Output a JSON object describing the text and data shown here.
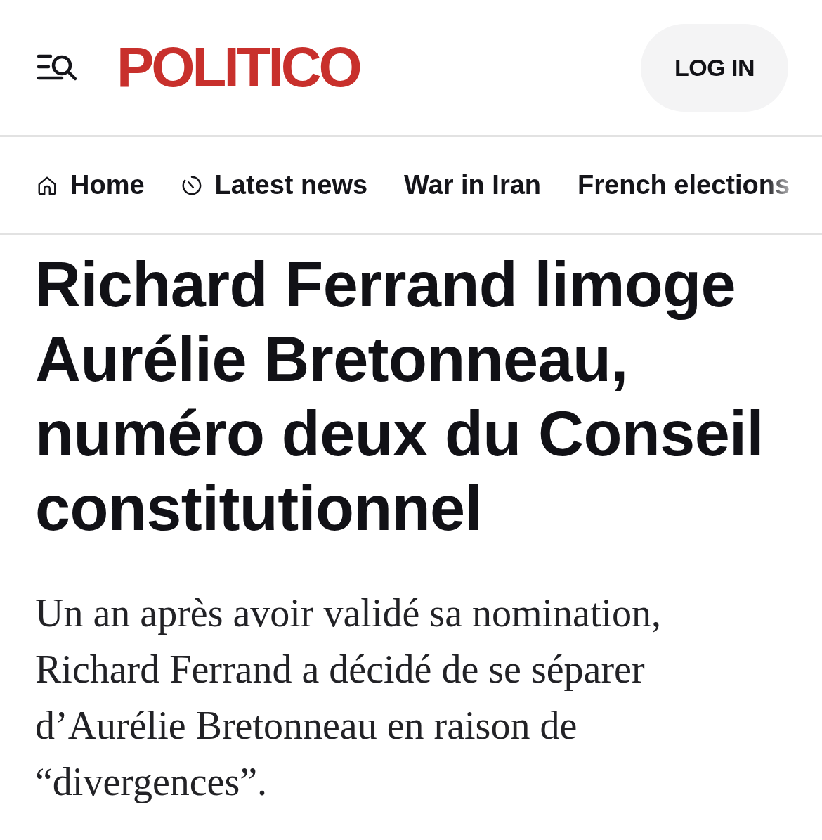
{
  "header": {
    "logo": "POLITICO",
    "login_button": "LOG IN"
  },
  "nav": {
    "items": [
      {
        "label": "Home",
        "kind": "home"
      },
      {
        "label": "Latest news",
        "kind": "latest"
      },
      {
        "label": "War in Iran",
        "kind": "topic"
      },
      {
        "label": "French elections",
        "kind": "topic"
      }
    ]
  },
  "article": {
    "headline": "Richard Ferrand limoge Aurélie Bretonneau, numéro deux du Conseil constitutionnel",
    "dek": "Un an après avoir validé sa nomination, Richard Ferrand a décidé de se séparer d’Aurélie Bretonneau en raison de “divergences”."
  }
}
